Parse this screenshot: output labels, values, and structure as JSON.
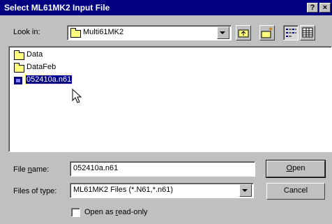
{
  "window": {
    "title": "Select ML61MK2 Input File",
    "help_label": "?",
    "close_label": "×"
  },
  "look_in": {
    "label": "Look in:",
    "value": "Multi61MK2"
  },
  "toolbar": {
    "icons": [
      "up-folder-icon",
      "new-folder-icon",
      "list-view-icon",
      "details-view-icon"
    ]
  },
  "file_list": {
    "items": [
      {
        "name": "Data",
        "type": "folder"
      },
      {
        "name": "DataFeb",
        "type": "folder"
      },
      {
        "name": "052410a.n61",
        "type": "file",
        "selected": true
      }
    ]
  },
  "file_name": {
    "label_pre": "File ",
    "label_u": "n",
    "label_post": "ame:",
    "value": "052410a.n61"
  },
  "file_type": {
    "label": "Files of type:",
    "value": "ML61MK2 Files (*.N61,*.n61)"
  },
  "buttons": {
    "open_u": "O",
    "open_rest": "pen",
    "cancel": "Cancel"
  },
  "readonly": {
    "label_pre": "Open as ",
    "label_u": "r",
    "label_post": "ead-only",
    "checked": false
  },
  "colors": {
    "title_bar": "#000080",
    "dialog_bg": "#c0c0c0",
    "selection": "#000080"
  }
}
